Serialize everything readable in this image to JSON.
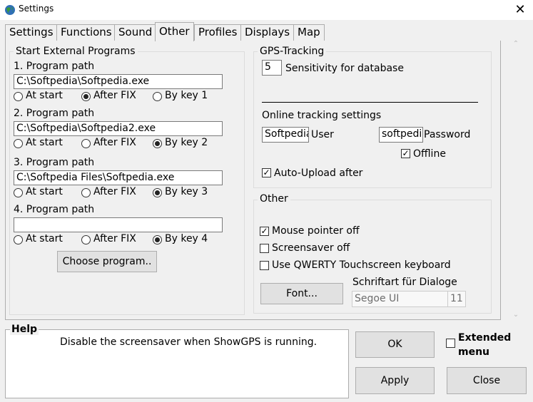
{
  "window": {
    "title": "Settings",
    "close_glyph": "✕"
  },
  "tabs": [
    {
      "label": "Settings",
      "active": false
    },
    {
      "label": "Functions",
      "active": false
    },
    {
      "label": "Sound",
      "active": false
    },
    {
      "label": "Other",
      "active": true
    },
    {
      "label": "Profiles",
      "active": false
    },
    {
      "label": "Displays",
      "active": false
    },
    {
      "label": "Map",
      "active": false
    }
  ],
  "external": {
    "title": "Start External Programs",
    "programs": [
      {
        "label": "1. Program path",
        "value": "C:\\Softpedia\\Softpedia.exe",
        "selected": "After FIX"
      },
      {
        "label": "2. Program path",
        "value": "C:\\Softpedia\\Softpedia2.exe",
        "selected": "By key 2"
      },
      {
        "label": "3. Program path",
        "value": "C:\\Softpedia Files\\Softpedia.exe",
        "selected": "By key 3"
      },
      {
        "label": "4. Program path",
        "value": "",
        "selected": "By key 4"
      }
    ],
    "options": [
      [
        "At start",
        "After FIX",
        "By key 1"
      ],
      [
        "At start",
        "After FIX",
        "By key 2"
      ],
      [
        "At start",
        "After FIX",
        "By key 3"
      ],
      [
        "At start",
        "After FIX",
        "By key 4"
      ]
    ],
    "choose_button": "Choose program.."
  },
  "gps": {
    "title": "GPS-Tracking",
    "sensitivity_value": "5",
    "sensitivity_label": "Sensitivity for database",
    "online_label": "Online tracking settings",
    "user_value": "Softpedia",
    "user_label": "User",
    "password_value": "softpedia",
    "password_label": "Password",
    "offline_label": "Offline",
    "offline_checked": true,
    "autoupload_label": "Auto-Upload after",
    "autoupload_checked": true
  },
  "other": {
    "title": "Other",
    "mouse_label": "Mouse pointer off",
    "mouse_checked": true,
    "screensaver_label": "Screensaver off",
    "screensaver_checked": false,
    "qwerty_label": "Use QWERTY Touchscreen keyboard",
    "qwerty_checked": false,
    "font_button": "Font...",
    "font_caption": "Schriftart für Dialoge",
    "font_name": "Segoe UI",
    "font_size": "11"
  },
  "help": {
    "title": "Help",
    "text": "Disable the screensaver when ShowGPS is running."
  },
  "buttons": {
    "ok": "OK",
    "apply": "Apply",
    "close": "Close",
    "extended_menu": "Extended menu",
    "extended_checked": false
  },
  "scroll": {
    "up_glyph": "⌃",
    "down_glyph": "⌄"
  },
  "colors": {
    "accent": "#0078d7",
    "border": "#adadad"
  }
}
